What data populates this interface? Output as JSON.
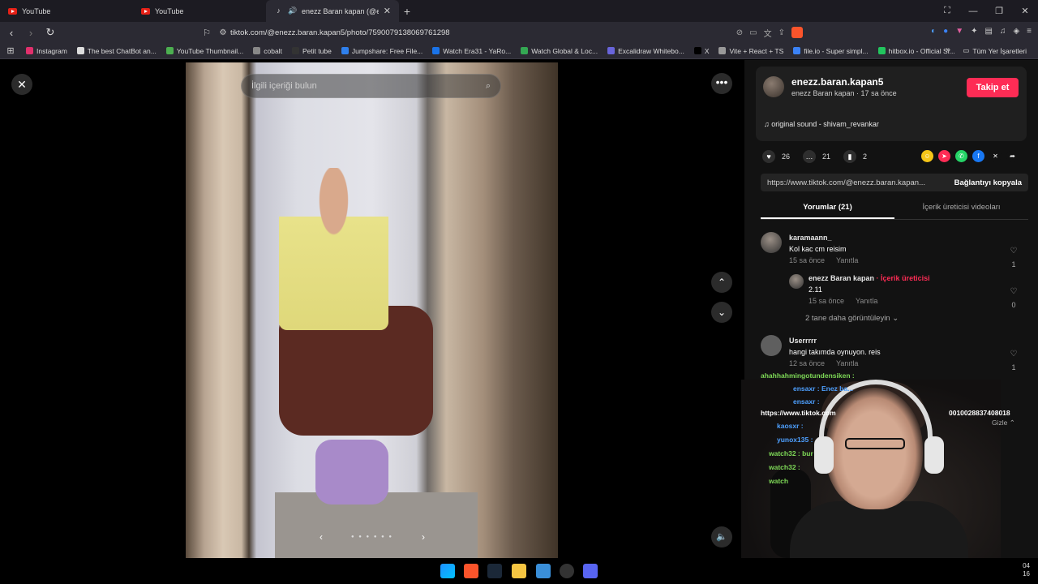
{
  "browser": {
    "tabs": [
      {
        "title": "YouTube",
        "icon": "youtube-icon",
        "active": false
      },
      {
        "title": "YouTube",
        "icon": "youtube-icon",
        "active": false
      },
      {
        "title": "enezz Baran kapan (@enezz.b",
        "icon": "tiktok-icon",
        "active": true
      }
    ],
    "url": "tiktok.com/@enezz.baran.kapan5/photo/7590079138069761298",
    "bookmarks": [
      {
        "label": "Instagram",
        "color": "#e1306c"
      },
      {
        "label": "The best ChatBot an...",
        "color": "#dddddd"
      },
      {
        "label": "YouTube Thumbnail...",
        "color": "#4caf50"
      },
      {
        "label": "cobalt",
        "color": "#888888"
      },
      {
        "label": "Petit tube",
        "color": "#333333"
      },
      {
        "label": "Jumpshare: Free File...",
        "color": "#2f80ed"
      },
      {
        "label": "Watch Era31 - YaRo...",
        "color": "#1a73e8"
      },
      {
        "label": "Watch Global & Loc...",
        "color": "#34a853"
      },
      {
        "label": "Excalidraw Whitebo...",
        "color": "#6965db"
      },
      {
        "label": "X",
        "color": "#000000"
      },
      {
        "label": "Vite + React + TS",
        "color": "#999999"
      },
      {
        "label": "file.io - Super simpl...",
        "color": "#3b82f6"
      },
      {
        "label": "hitbox.io - Official Si...",
        "color": "#22c55e"
      }
    ],
    "bookmarks_more": "»",
    "all_bookmarks": "Tüm Yer İşaretleri"
  },
  "viewer": {
    "search_placeholder": "İlgili içeriği bulun",
    "close": "✕",
    "more": "•••",
    "up": "⌃",
    "down": "⌄",
    "prev": "‹",
    "next": "›",
    "dots": "● ● ● ● ● ●",
    "volume": "🔈"
  },
  "author": {
    "username": "enezz.baran.kapan5",
    "subtitle": "enezz Baran kapan · 17 sa önce",
    "follow": "Takip et",
    "sound": "♫  original sound - shivam_revankar"
  },
  "stats": {
    "likes": "26",
    "comments": "21",
    "saves": "2"
  },
  "share": {
    "link": "https://www.tiktok.com/@enezz.baran.kapan...",
    "copy": "Bağlantıyı kopyala"
  },
  "tabs": {
    "comments": "Yorumlar (21)",
    "creator_videos": "İçerik üreticisi videoları"
  },
  "comments": [
    {
      "user": "karamaann_",
      "text": "Kol kac cm reisim",
      "time": "15 sa önce",
      "reply": "Yanıtla",
      "likes": "1"
    },
    {
      "user": "enezz Baran kapan",
      "tag": "· İçerik üreticisi",
      "text": "2.11",
      "time": "15 sa önce",
      "reply": "Yanıtla",
      "likes": "0"
    },
    {
      "user": "Userrrrr",
      "text": "hangi takımda oynuyon. reis",
      "time": "12 sa önce",
      "reply": "Yanıtla",
      "likes": "1"
    }
  ],
  "more_replies": "2 tane daha görüntüleyin ⌄",
  "chat_overlay": [
    {
      "user": "ahahhahmingotundensiken :",
      "color": "green"
    },
    {
      "user": "ensaxr : Enez ba...",
      "color": "blue"
    },
    {
      "user": "ensaxr :",
      "color": "blue"
    },
    {
      "user": "https://www.tiktok.com",
      "color": "white"
    },
    {
      "user": "kaosxr :",
      "color": "blue"
    },
    {
      "user": "yunox135 :",
      "color": "blue"
    },
    {
      "user": "watch32 : bur",
      "color": "green"
    },
    {
      "user": "watch32 :",
      "color": "green"
    },
    {
      "user": "watch",
      "color": "green"
    }
  ],
  "chat_extra": {
    "url_tail": "0010028837408018",
    "hide": "Gizle ⌃"
  },
  "taskbar": {
    "clock_line1": "04",
    "clock_line2": "16"
  }
}
